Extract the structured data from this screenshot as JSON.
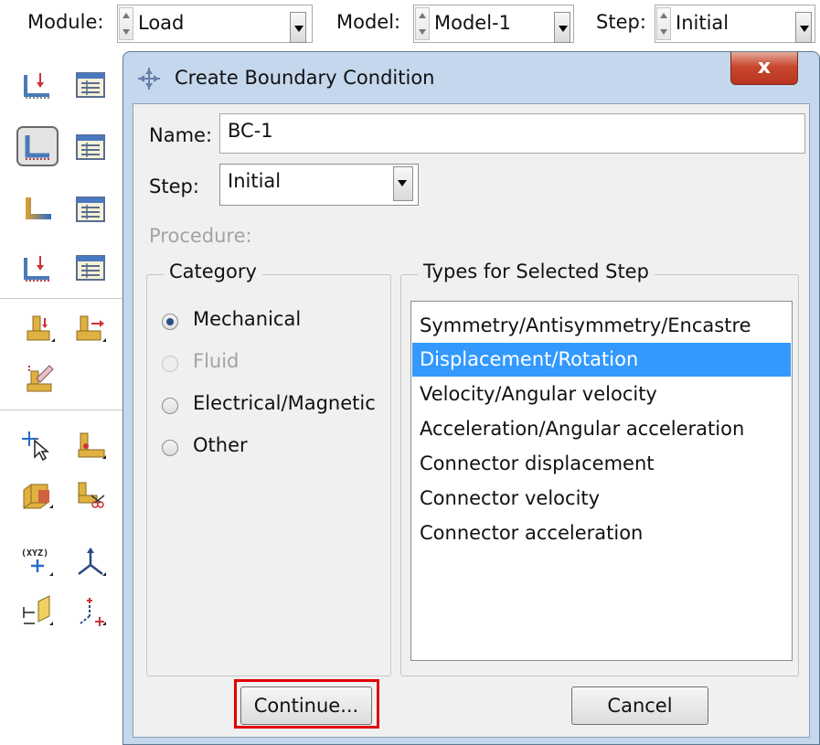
{
  "context_bar": {
    "module_label": "Module:",
    "module_value": "Load",
    "model_label": "Model:",
    "model_value": "Model-1",
    "step_label": "Step:",
    "step_value": "Initial"
  },
  "toolbox": {
    "icons": [
      "create-load-icon",
      "load-manager-icon",
      "create-bc-icon",
      "bc-manager-icon",
      "create-predefined-field-icon",
      "predefined-field-manager-icon",
      "create-load-case-icon",
      "load-case-manager-icon",
      "special-loads-icon",
      "special-bc-icon",
      "edit-attribute-icon",
      "query-tool-icon",
      "set-bc-icon",
      "partition-icon",
      "cut-tool-icon",
      "create-datum-csys-icon",
      "datum-axis-icon",
      "datum-plane-icon",
      "datum-point-icon"
    ]
  },
  "dialog": {
    "title": "Create Boundary Condition",
    "close_label": "x",
    "name_label": "Name:",
    "name_value": "BC-1",
    "step_label": "Step:",
    "step_value": "Initial",
    "procedure_label": "Procedure:",
    "category": {
      "title": "Category",
      "options": [
        {
          "label": "Mechanical",
          "checked": true,
          "enabled": true
        },
        {
          "label": "Fluid",
          "checked": false,
          "enabled": false
        },
        {
          "label": "Electrical/Magnetic",
          "checked": false,
          "enabled": true
        },
        {
          "label": "Other",
          "checked": false,
          "enabled": true
        }
      ]
    },
    "types": {
      "title": "Types for Selected Step",
      "items": [
        "Symmetry/Antisymmetry/Encastre",
        "Displacement/Rotation",
        "Velocity/Angular velocity",
        "Acceleration/Angular acceleration",
        "Connector displacement",
        "Connector velocity",
        "Connector acceleration"
      ],
      "selected_index": 1
    },
    "continue_label": "Continue...",
    "cancel_label": "Cancel"
  },
  "colors": {
    "selection": "#3399ff",
    "dialog_frame": "#c4d7ec",
    "close_button": "#c8482f",
    "highlight": "#e00000"
  }
}
